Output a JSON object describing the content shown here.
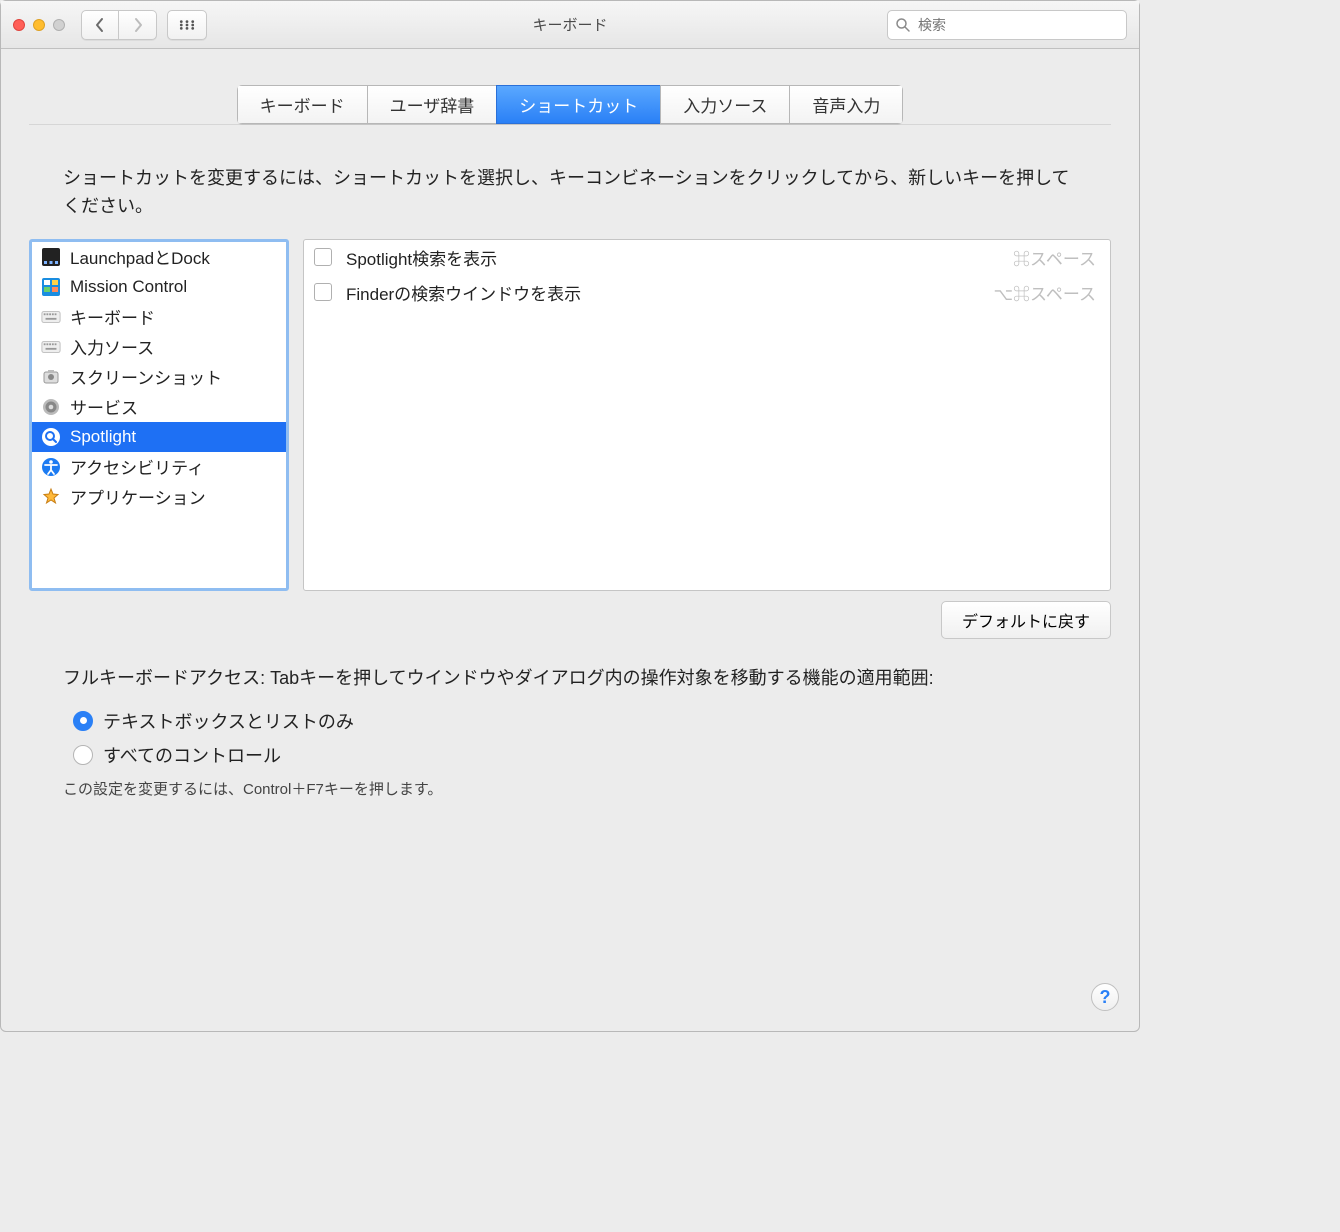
{
  "window": {
    "title": "キーボード"
  },
  "search": {
    "placeholder": "検索"
  },
  "tabs": {
    "items": [
      "キーボード",
      "ユーザ辞書",
      "ショートカット",
      "入力ソース",
      "音声入力"
    ],
    "active_index": 2
  },
  "instruction": "ショートカットを変更するには、ショートカットを選択し、キーコンビネーションをクリックしてから、新しいキーを押してください。",
  "categories": [
    {
      "label": "LaunchpadとDock",
      "icon": "launchpad"
    },
    {
      "label": "Mission Control",
      "icon": "mission-control"
    },
    {
      "label": "キーボード",
      "icon": "keyboard"
    },
    {
      "label": "入力ソース",
      "icon": "keyboard"
    },
    {
      "label": "スクリーンショット",
      "icon": "screenshot"
    },
    {
      "label": "サービス",
      "icon": "gear"
    },
    {
      "label": "Spotlight",
      "icon": "spotlight",
      "selected": true
    },
    {
      "label": "アクセシビリティ",
      "icon": "accessibility"
    },
    {
      "label": "アプリケーション",
      "icon": "appstore"
    }
  ],
  "shortcuts": [
    {
      "checked": false,
      "label": "Spotlight検索を表示",
      "key": "⌘スペース"
    },
    {
      "checked": false,
      "label": "Finderの検索ウインドウを表示",
      "key": "⌥⌘スペース"
    }
  ],
  "defaults_button": "デフォルトに戻す",
  "full_keyboard_access": {
    "title": "フルキーボードアクセス: Tabキーを押してウインドウやダイアログ内の操作対象を移動する機能の適用範囲:",
    "option_a": "テキストボックスとリストのみ",
    "option_b": "すべてのコントロール",
    "selected": "a",
    "hint": "この設定を変更するには、Control＋F7キーを押します。"
  }
}
